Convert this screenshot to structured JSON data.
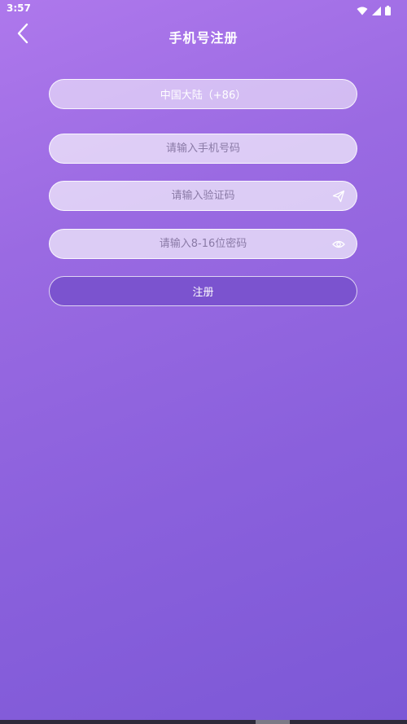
{
  "status_bar": {
    "time": "3:57",
    "icons": [
      "wifi-icon",
      "signal-icon",
      "battery-icon"
    ]
  },
  "header": {
    "title": "手机号注册",
    "back_icon": "chevron-left-icon"
  },
  "form": {
    "country": "中国大陆（+86）",
    "phone_placeholder": "请输入手机号码",
    "code_placeholder": "请输入验证码",
    "code_icon": "send-icon",
    "password_placeholder": "请输入8-16位密码",
    "password_icon": "eye-icon",
    "register_label": "注册"
  },
  "colors": {
    "background_top": "#ae78ec",
    "background_bottom": "#7c58d6",
    "button": "#7b53cf"
  }
}
